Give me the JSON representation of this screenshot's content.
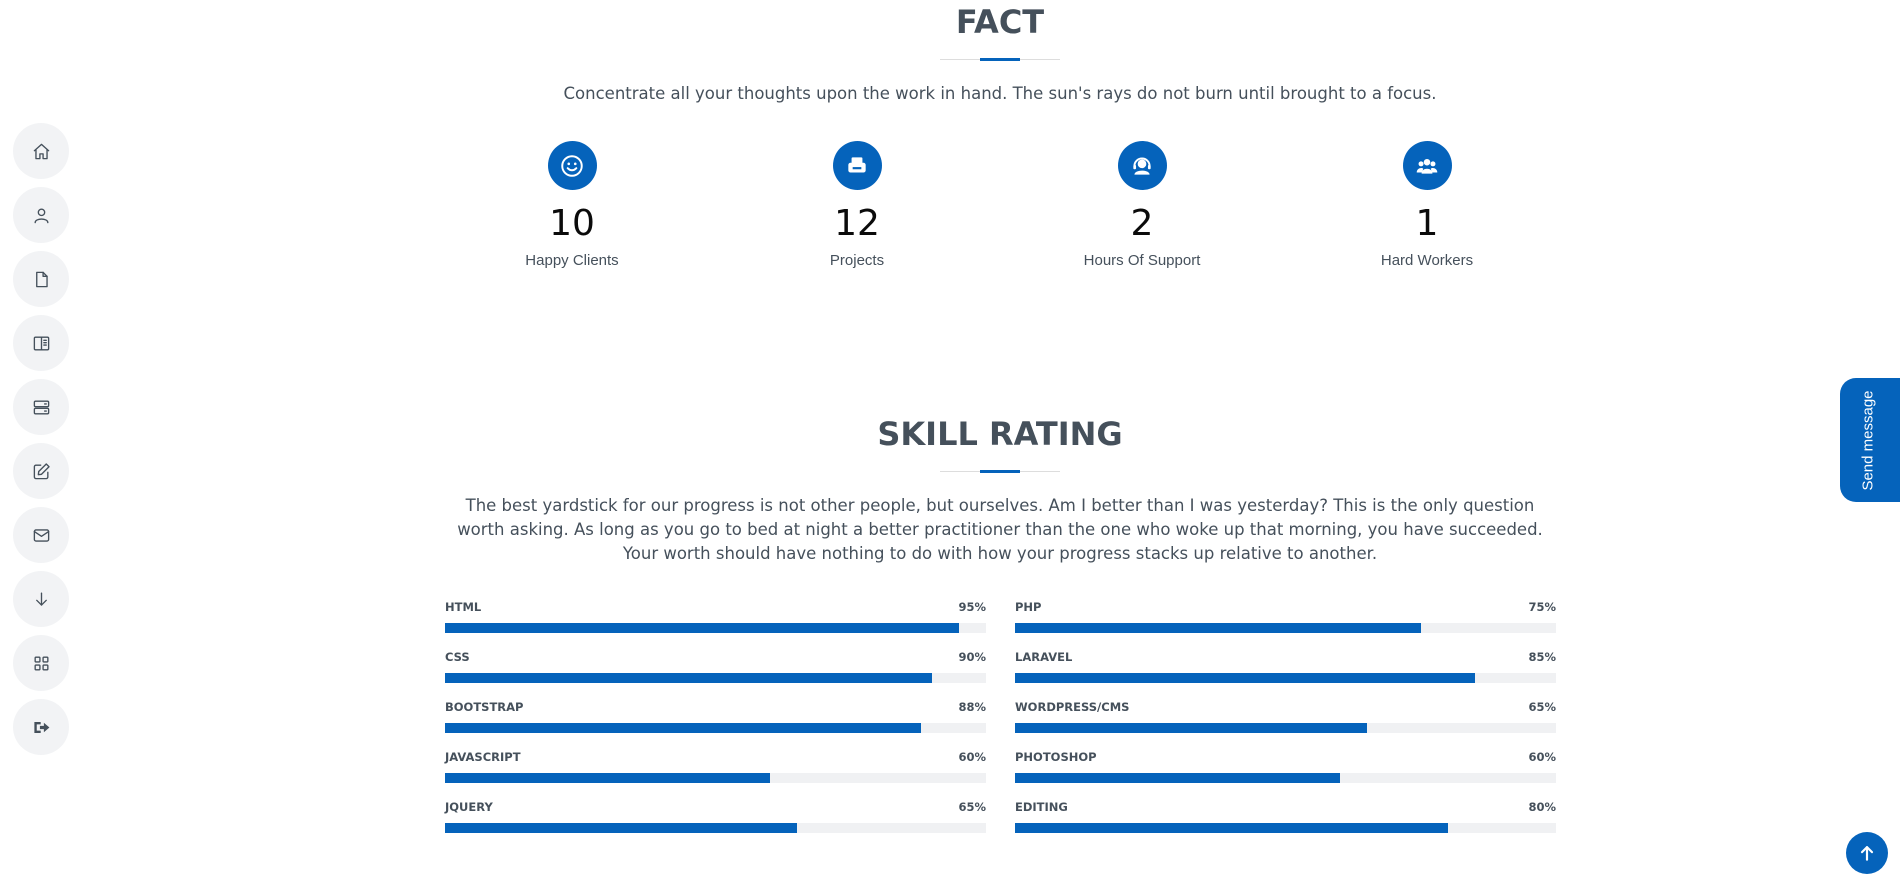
{
  "sidebar": {
    "items": [
      {
        "name": "home",
        "icon": "home-icon"
      },
      {
        "name": "about",
        "icon": "person-icon"
      },
      {
        "name": "resume",
        "icon": "file-icon"
      },
      {
        "name": "portfolio",
        "icon": "book-half-icon"
      },
      {
        "name": "services",
        "icon": "server-icon"
      },
      {
        "name": "blog",
        "icon": "pencil-square-icon"
      },
      {
        "name": "contact",
        "icon": "envelope-icon"
      },
      {
        "name": "download",
        "icon": "arrow-down-icon"
      },
      {
        "name": "apps",
        "icon": "grid-icon"
      },
      {
        "name": "logout",
        "icon": "sign-out-icon"
      }
    ]
  },
  "facts": {
    "title": "FACT",
    "description": "Concentrate all your thoughts upon the work in hand. The sun's rays do not burn until brought to a focus.",
    "items": [
      {
        "value": "10",
        "label": "Happy Clients",
        "icon": "smile-icon"
      },
      {
        "value": "12",
        "label": "Projects",
        "icon": "printer-icon"
      },
      {
        "value": "2",
        "label": "Hours Of Support",
        "icon": "headset-icon"
      },
      {
        "value": "1",
        "label": "Hard Workers",
        "icon": "people-icon"
      }
    ]
  },
  "skills": {
    "title": "SKILL RATING",
    "description": "The best yardstick for our progress is not other people, but ourselves. Am I better than I was yesterday? This is the only question worth asking. As long as you go to bed at night a better practitioner than the one who woke up that morning, you have succeeded. Your worth should have nothing to do with how your progress stacks up relative to another.",
    "left": [
      {
        "name": "HTML",
        "value": "95%",
        "percent": 95
      },
      {
        "name": "CSS",
        "value": "90%",
        "percent": 90
      },
      {
        "name": "BOOTSTRAP",
        "value": "88%",
        "percent": 88
      },
      {
        "name": "JAVASCRIPT",
        "value": "60%",
        "percent": 60
      },
      {
        "name": "JQUERY",
        "value": "65%",
        "percent": 65
      }
    ],
    "right": [
      {
        "name": "PHP",
        "value": "75%",
        "percent": 75
      },
      {
        "name": "LARAVEL",
        "value": "85%",
        "percent": 85
      },
      {
        "name": "WORDPRESS/CMS",
        "value": "65%",
        "percent": 65
      },
      {
        "name": "PHOTOSHOP",
        "value": "60%",
        "percent": 60
      },
      {
        "name": "EDITING",
        "value": "80%",
        "percent": 80
      }
    ]
  },
  "send_message": {
    "label": "Send message"
  },
  "back_to_top": {
    "icon": "arrow-up-icon"
  },
  "colors": {
    "accent": "#0563bb",
    "text": "#45505b",
    "nav_bg": "#f2f3f5"
  }
}
